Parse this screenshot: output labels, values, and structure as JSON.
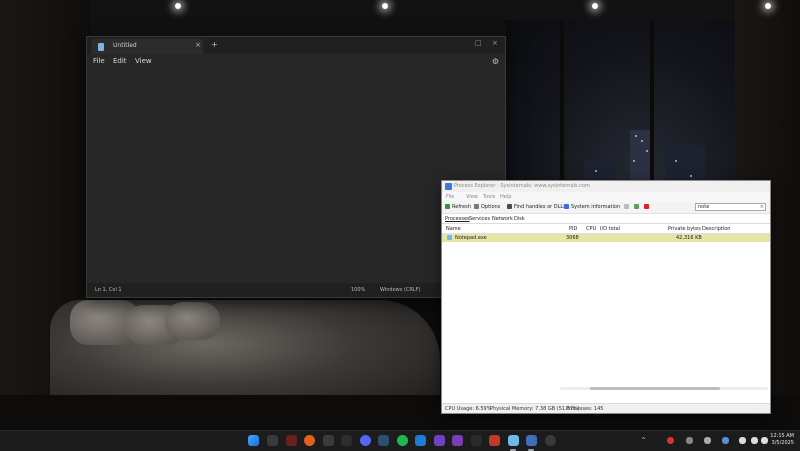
{
  "notepad": {
    "tab_title": "Untitled",
    "tab_close": "×",
    "new_tab": "+",
    "menus": [
      "File",
      "Edit",
      "View"
    ],
    "window_controls": [
      "□",
      "×"
    ],
    "status": {
      "position": "Ln 1, Col 1",
      "zoom": "100%",
      "line_ending": "Windows (CRLF)"
    }
  },
  "process_explorer": {
    "title": "Process Explorer - Sysinternals: www.sysinternals.com",
    "menus": [
      "File",
      "View",
      "Tools",
      "Help"
    ],
    "toolbar": {
      "refresh": "Refresh",
      "options": "Options",
      "find": "Find handles or DLLs",
      "sysinfo": "System information"
    },
    "search_value": "note",
    "tabs": [
      "Processes",
      "Services",
      "Network",
      "Disk"
    ],
    "columns": [
      "Name",
      "PID",
      "CPU",
      "I/O total",
      "Private bytes",
      "Description"
    ],
    "rows": [
      {
        "name": "Notepad.exe",
        "pid": "3068",
        "cpu": "",
        "io": "",
        "private": "42,316 KB",
        "desc": ""
      }
    ],
    "status": {
      "cpu": "CPU Usage: 6.59%",
      "memory": "Physical Memory: 7.38 GB (51.57%)",
      "processes": "Processes: 145"
    }
  },
  "taskbar": {
    "clock_time": "12:15 AM",
    "clock_date": "3/5/2025",
    "tray_chevron": "^"
  },
  "colors": {
    "notepad_bg": "#272727",
    "selected_row": "#e7e4a6",
    "taskbar": "#1c1c1c"
  }
}
